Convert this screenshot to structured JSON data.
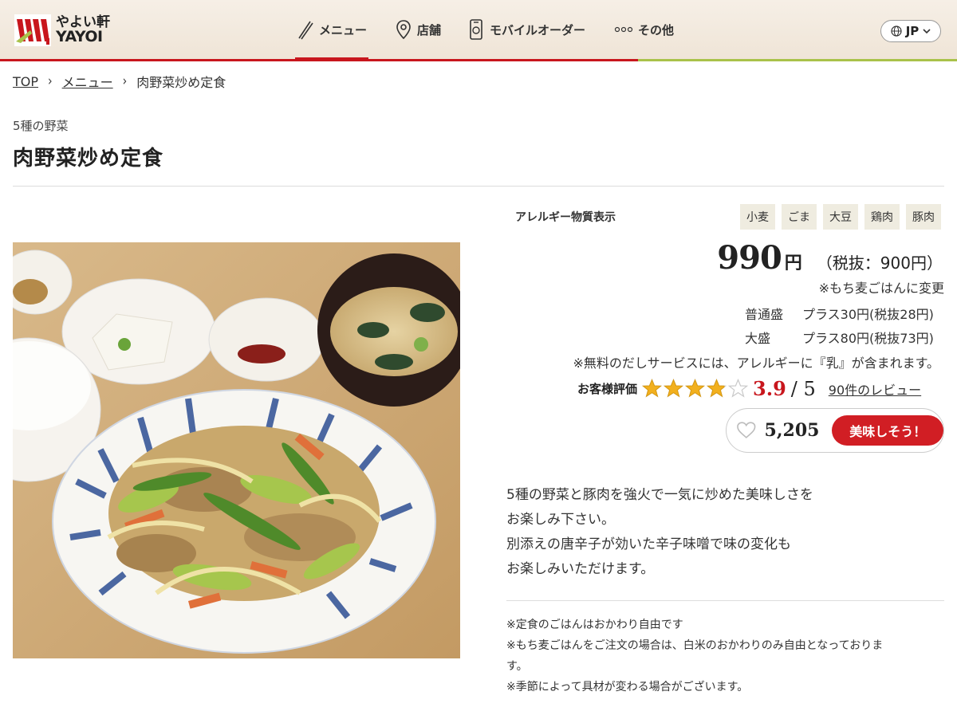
{
  "header": {
    "logo_jp": "やよい軒",
    "logo_en": "YAYOI",
    "nav": [
      {
        "label": "メニュー",
        "icon": "chopsticks-icon"
      },
      {
        "label": "店舗",
        "icon": "map-pin-icon"
      },
      {
        "label": "モバイルオーダー",
        "icon": "smartphone-icon"
      },
      {
        "label": "その他",
        "icon": "more-dots-icon"
      }
    ],
    "lang": "JP",
    "colors": {
      "brand_red": "#c8161d",
      "accent_green": "#a9c24a"
    }
  },
  "breadcrumb": {
    "top": "TOP",
    "menu": "メニュー",
    "current": "肉野菜炒め定食"
  },
  "product": {
    "subtitle": "5種の野菜",
    "title": "肉野菜炒め定食",
    "allergy_label": "アレルギー物質表示",
    "allergens": [
      "小麦",
      "ごま",
      "大豆",
      "鶏肉",
      "豚肉"
    ],
    "price": "990",
    "price_unit": "円",
    "price_tax_note": "（税抜：900円）",
    "mochi_note": "※もち麦ごはんに変更",
    "options": [
      {
        "label": "普通盛",
        "value": "プラス30円(税抜28円)"
      },
      {
        "label": "大盛",
        "value": "プラス80円(税抜73円)"
      }
    ],
    "dashi_note": "※無料のだしサービスには、アレルギーに『乳』が含まれます。",
    "rating_label": "お客様評価",
    "rating_score": "3.9",
    "rating_max": "/ 5",
    "rating_value": 3.9,
    "review_link": "90件のレビュー",
    "like_count": "5,205",
    "like_button": "美味しそう！",
    "description": [
      "5種の野菜と豚肉を強火で一気に炒めた美味しさを",
      "お楽しみ下さい。",
      "別添えの唐辛子が効いた辛子味噌で味の変化も",
      "お楽しみいただけます。"
    ],
    "notes": [
      "※定食のごはんはおかわり自由です",
      "※もち麦ごはんをご注文の場合は、白米のおかわりのみ自由となっておりま",
      "す。",
      "※季節によって具材が変わる場合がございます。"
    ]
  }
}
